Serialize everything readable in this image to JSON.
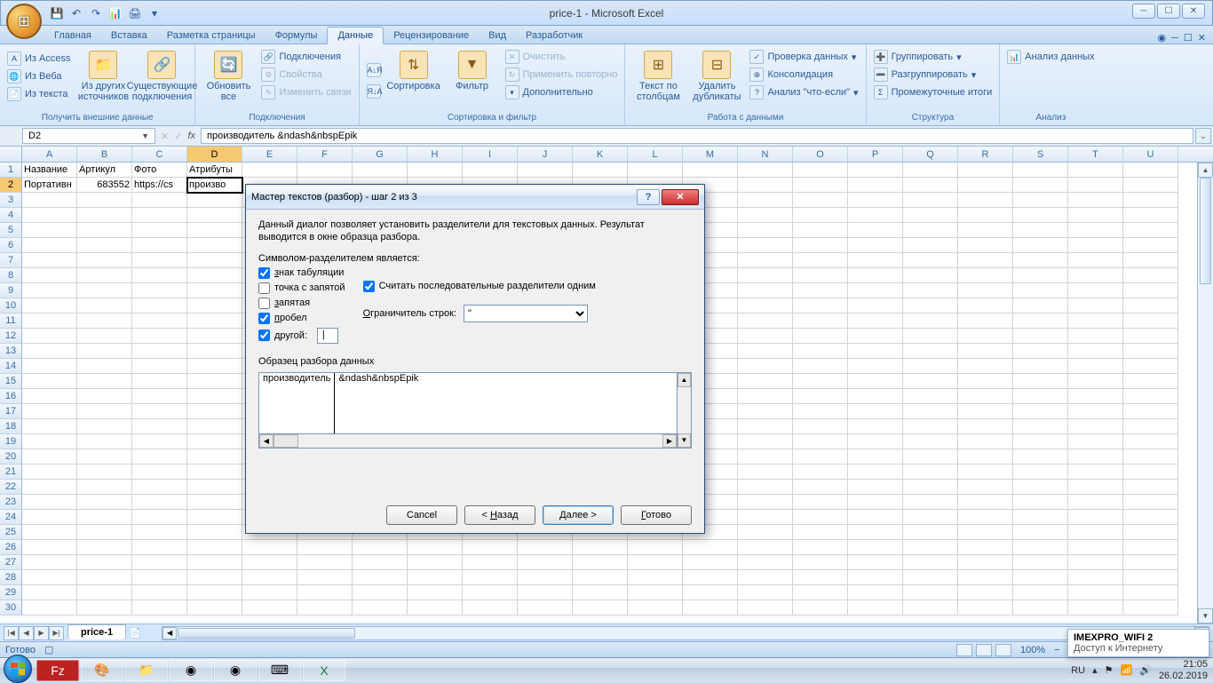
{
  "window": {
    "title": "price-1 - Microsoft Excel"
  },
  "ribbon_tabs": {
    "home": "Главная",
    "insert": "Вставка",
    "page": "Разметка страницы",
    "formulas": "Формулы",
    "data": "Данные",
    "review": "Рецензирование",
    "view": "Вид",
    "developer": "Разработчик"
  },
  "ribbon": {
    "g1": {
      "access": "Из Access",
      "web": "Из Веба",
      "text": "Из текста",
      "other": "Из других источников",
      "existing": "Существующие подключения",
      "title": "Получить внешние данные"
    },
    "g2": {
      "refresh": "Обновить все",
      "conns": "Подключения",
      "props": "Свойства",
      "editlinks": "Изменить связи",
      "title": "Подключения"
    },
    "g3": {
      "sortaz": "А↓Я",
      "sortza": "Я↓А",
      "sort": "Сортировка",
      "filter": "Фильтр",
      "clear": "Очистить",
      "reapply": "Применить повторно",
      "advanced": "Дополнительно",
      "title": "Сортировка и фильтр"
    },
    "g4": {
      "ttc": "Текст по столбцам",
      "dedup": "Удалить дубликаты",
      "dv": "Проверка данных",
      "consol": "Консолидация",
      "whatif": "Анализ \"что-если\"",
      "title": "Работа с данными"
    },
    "g5": {
      "group": "Группировать",
      "ungroup": "Разгруппировать",
      "subtotal": "Промежуточные итоги",
      "title": "Структура"
    },
    "g6": {
      "analysis": "Анализ данных",
      "title": "Анализ"
    }
  },
  "namebox": "D2",
  "formula": "производитель &ndash&nbspEpik",
  "columns": [
    "A",
    "B",
    "C",
    "D",
    "E",
    "F",
    "G",
    "H",
    "I",
    "J",
    "K",
    "L",
    "M",
    "N",
    "O",
    "P",
    "Q",
    "R",
    "S",
    "T",
    "U"
  ],
  "headers": {
    "A": "Название",
    "B": "Артикул",
    "C": "Фото",
    "D": "Атрибуты"
  },
  "row2": {
    "A": "Портативн",
    "B": "683552",
    "C": "https://cs",
    "D": "произво"
  },
  "sheet": {
    "name": "price-1",
    "status": "Готово",
    "zoom": "100%"
  },
  "dialog": {
    "title": "Мастер текстов (разбор) - шаг 2 из 3",
    "desc": "Данный диалог позволяет установить разделители для текстовых данных. Результат выводится в окне образца разбора.",
    "delim_label": "Символом-разделителем является:",
    "tab": "знак табуляции",
    "semi": "точка с запятой",
    "comma": "запятая",
    "space": "пробел",
    "other": "другой:",
    "other_val": "|",
    "consecutive": "Считать последовательные разделители одним",
    "qualifier_label": "Ограничитель строк:",
    "qualifier_value": "\"",
    "preview_label": "Образец разбора данных",
    "preview_col1": "производитель",
    "preview_col2": "&ndash&nbspEpik",
    "btn_cancel": "Cancel",
    "btn_back": "< Назад",
    "btn_next": "Далее >",
    "btn_finish": "Готово"
  },
  "wifi": {
    "ssid": "IMEXPRO_WIFI 2",
    "status": "Доступ к Интернету"
  },
  "tray": {
    "lang": "",
    "time": "21:05",
    "date": "26.02.2019",
    "kbd": "RU"
  }
}
